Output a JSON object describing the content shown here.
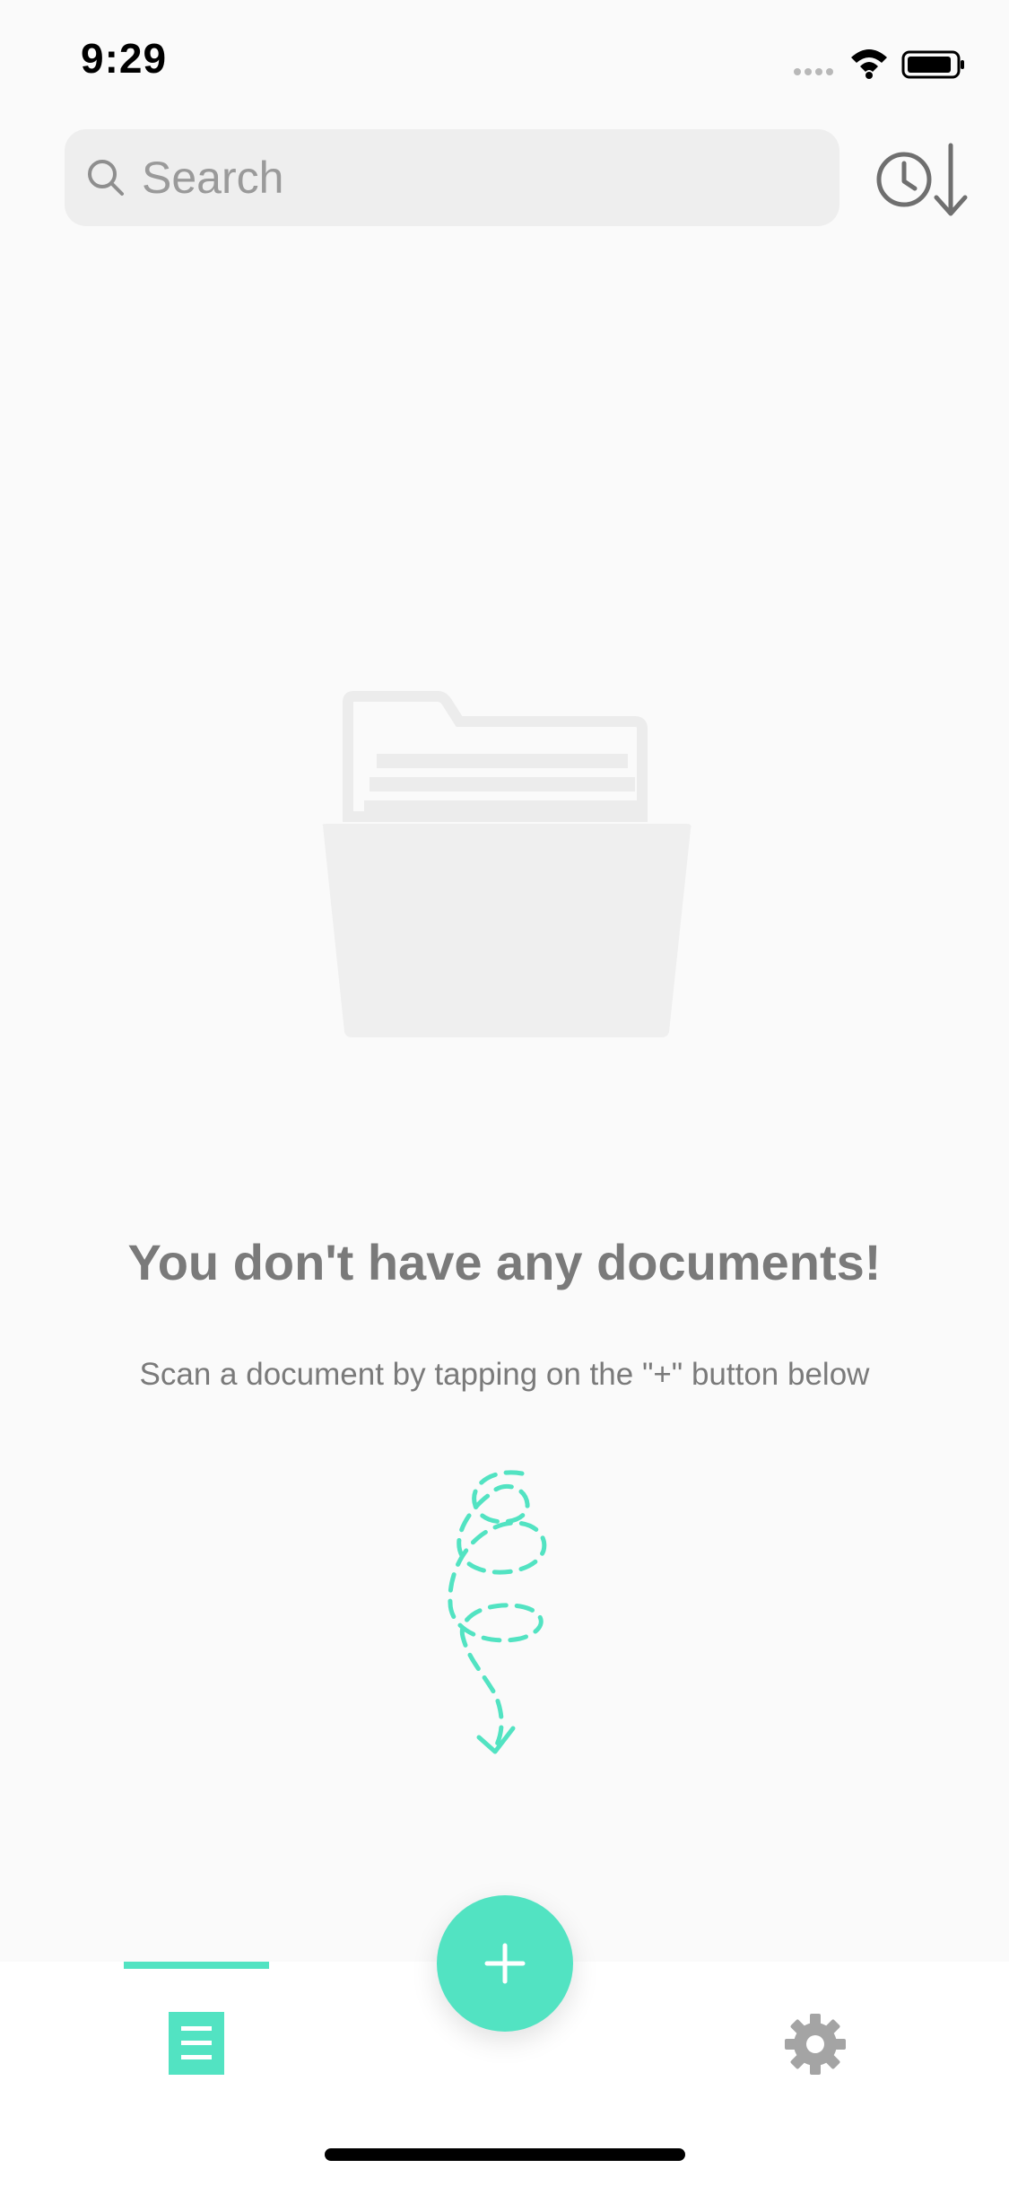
{
  "status_bar": {
    "time": "9:29"
  },
  "search": {
    "placeholder": "Search",
    "value": ""
  },
  "icons": {
    "search": "search-icon",
    "sort": "sort-by-date-icon",
    "cellular": "cellular-icon",
    "wifi": "wifi-icon",
    "battery": "battery-icon",
    "folder": "empty-folder-icon",
    "arrow": "squiggle-arrow-icon",
    "documents_tab": "document-list-icon",
    "settings_tab": "gear-icon",
    "add": "plus-icon"
  },
  "empty_state": {
    "title": "You don't have any documents!",
    "subtitle": "Scan a document by tapping on the \"+\" button below"
  },
  "colors": {
    "accent": "#52e3c2",
    "background": "#fafafa",
    "text_muted": "#7a7a7a",
    "search_bg": "#eeeeee"
  }
}
